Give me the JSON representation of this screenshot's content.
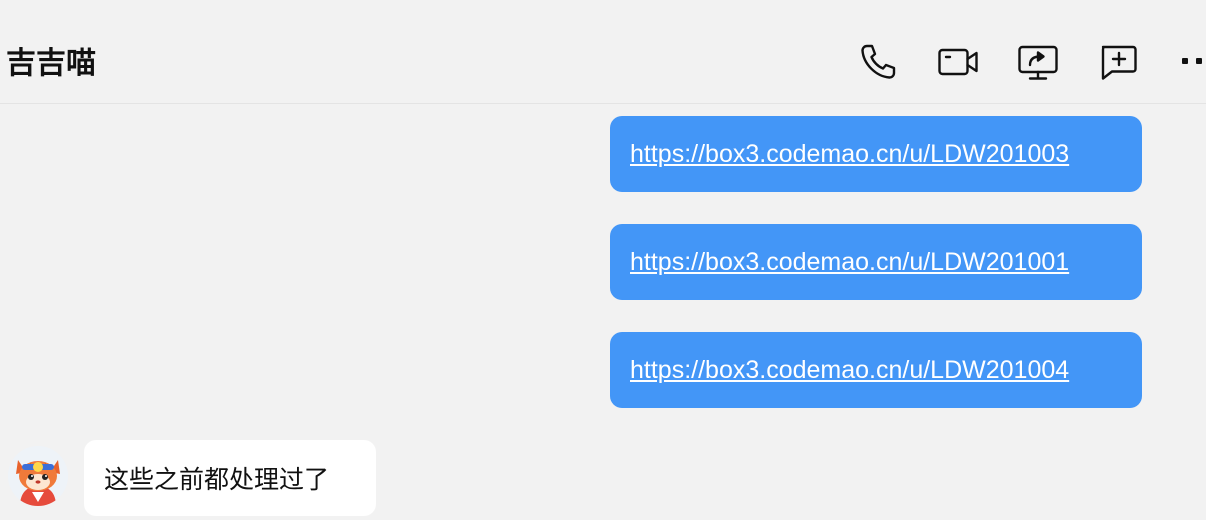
{
  "header": {
    "title": "吉吉喵",
    "icons": [
      "phone-icon",
      "video-call-icon",
      "screen-share-icon",
      "add-comment-icon",
      "more-icon"
    ]
  },
  "messages": {
    "outgoing": [
      {
        "text": "https://box3.codemao.cn/u/LDW201003"
      },
      {
        "text": "https://box3.codemao.cn/u/LDW201001"
      },
      {
        "text": "https://box3.codemao.cn/u/LDW201004"
      }
    ],
    "incoming": [
      {
        "text": "这些之前都处理过了",
        "avatar": "tiger-cat-avatar"
      }
    ]
  },
  "colors": {
    "background": "#f2f2f2",
    "outgoing_bubble": "#4396f7",
    "incoming_bubble": "#ffffff",
    "link_text": "#ffffff"
  }
}
